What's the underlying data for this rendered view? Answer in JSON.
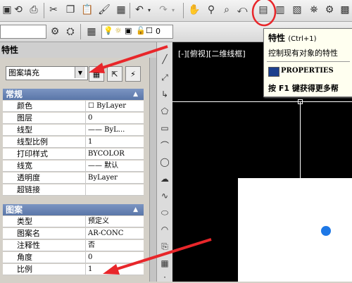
{
  "toolbar": {
    "layer_value": "0"
  },
  "palette": {
    "title": "特性",
    "object_type": "图案填充"
  },
  "sections": {
    "general": {
      "title": "常规",
      "rows": [
        {
          "key": "颜色",
          "value": "☐ ByLayer"
        },
        {
          "key": "图层",
          "value": "0"
        },
        {
          "key": "线型",
          "value": "—— ByL..."
        },
        {
          "key": "线型比例",
          "value": "1"
        },
        {
          "key": "打印样式",
          "value": "BYCOLOR"
        },
        {
          "key": "线宽",
          "value": "—— 默认"
        },
        {
          "key": "透明度",
          "value": "ByLayer"
        },
        {
          "key": "超链接",
          "value": ""
        }
      ]
    },
    "hatch": {
      "title": "图案",
      "rows": [
        {
          "key": "类型",
          "value": "预定义"
        },
        {
          "key": "图案名",
          "value": "AR-CONC"
        },
        {
          "key": "注释性",
          "value": "否"
        },
        {
          "key": "角度",
          "value": "0"
        },
        {
          "key": "比例",
          "value": "1"
        }
      ]
    }
  },
  "viewport": {
    "label": "[-][俯视][二维线框]"
  },
  "tooltip": {
    "title": "特性",
    "shortcut": "(Ctrl+1)",
    "description": "控制现有对象的特性",
    "command": "PROPERTIES",
    "help": "按 F1 键获得更多帮"
  },
  "colors": {
    "highlight": "#e8262a",
    "arrow": "#e8262a",
    "section_header": "#6a84b6",
    "point": "#1e78e6"
  }
}
